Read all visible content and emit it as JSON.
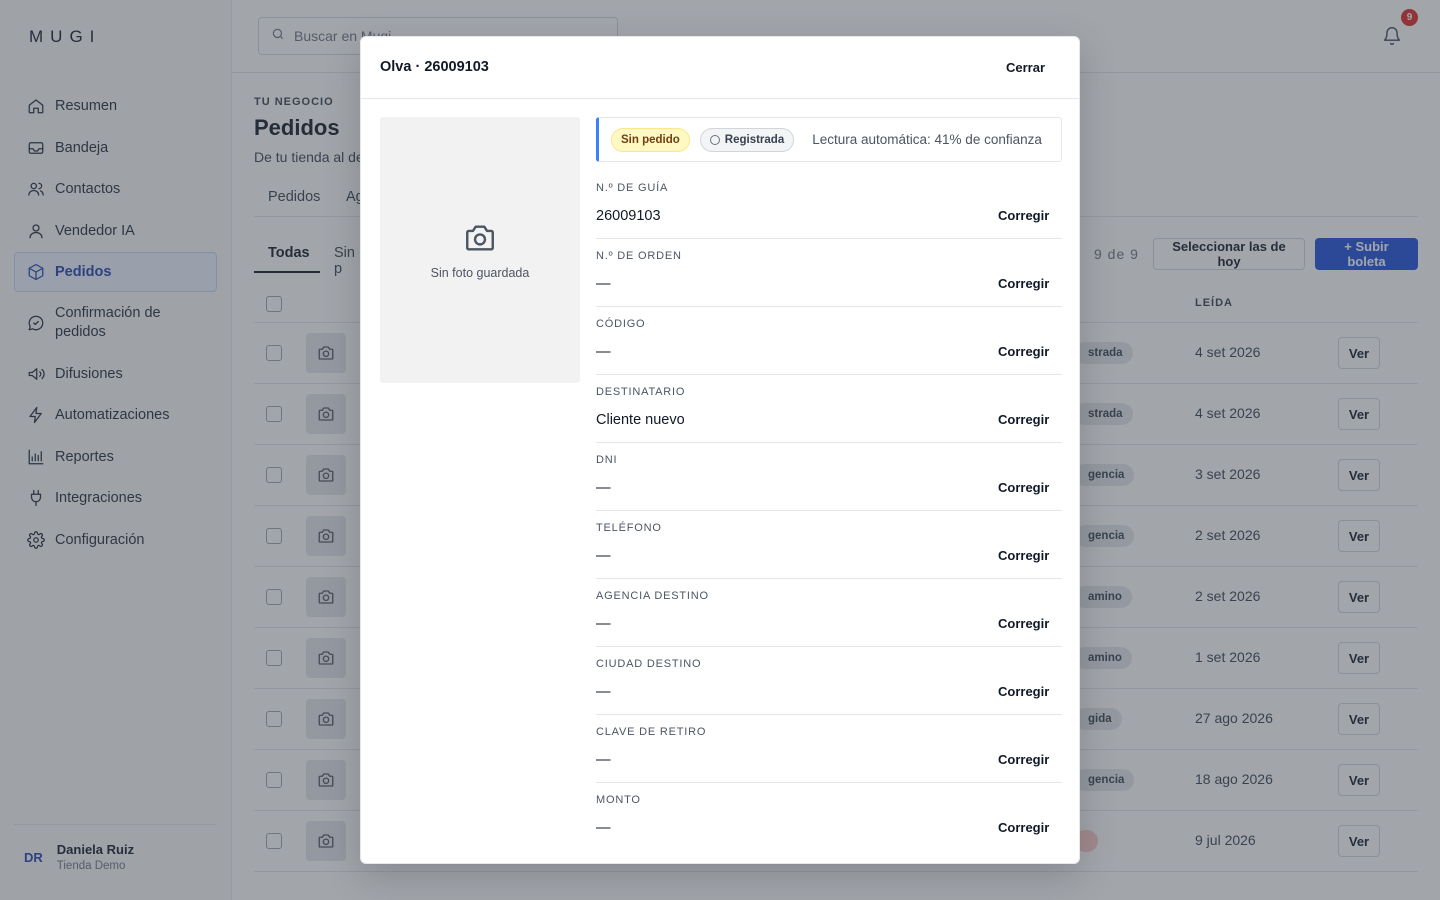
{
  "app": {
    "logo": "MUGI"
  },
  "sidebar": {
    "items": [
      {
        "label": "Resumen",
        "icon": "home-icon"
      },
      {
        "label": "Bandeja",
        "icon": "inbox-icon"
      },
      {
        "label": "Contactos",
        "icon": "users-icon"
      },
      {
        "label": "Vendedor IA",
        "icon": "user-icon"
      },
      {
        "label": "Pedidos",
        "icon": "box-icon",
        "active": true
      },
      {
        "label": "Confirmación de pedidos",
        "icon": "chat-bubble-icon"
      },
      {
        "label": "Difusiones",
        "icon": "megaphone-icon"
      },
      {
        "label": "Automatizaciones",
        "icon": "lightning-icon"
      },
      {
        "label": "Reportes",
        "icon": "bar-chart-icon"
      },
      {
        "label": "Integraciones",
        "icon": "plug-icon"
      },
      {
        "label": "Configuración",
        "icon": "gear-icon"
      }
    ],
    "user": {
      "initials": "DR",
      "name": "Daniela Ruiz",
      "shop": "Tienda Demo"
    }
  },
  "topbar": {
    "search_placeholder": "Buscar en Mugi",
    "notifications_count": "9"
  },
  "page": {
    "eyebrow": "TU NEGOCIO",
    "title": "Pedidos",
    "subtitle": "De tu tienda al de",
    "tabs": [
      "Pedidos",
      "Ag"
    ],
    "subtabs": [
      "Todas",
      "Sin p"
    ],
    "count": "9 de 9",
    "select_today_label": "Seleccionar las de hoy",
    "upload_label": "+ Subir boleta"
  },
  "table": {
    "header_read": "LEÍDA",
    "view_label": "Ver",
    "rows": [
      {
        "status": "strada",
        "date": "4 set 2026"
      },
      {
        "status": "strada",
        "date": "4 set 2026"
      },
      {
        "status": "gencia",
        "date": "3 set 2026"
      },
      {
        "status": "gencia",
        "date": "2 set 2026"
      },
      {
        "status": "amino",
        "date": "2 set 2026"
      },
      {
        "status": "amino",
        "date": "1 set 2026"
      },
      {
        "status": "gida",
        "date": "27 ago 2026"
      },
      {
        "status": "gencia",
        "date": "18 ago 2026"
      },
      {
        "status": "",
        "date": "9 jul 2026",
        "red": true
      }
    ]
  },
  "modal": {
    "title": "Olva · 26009103",
    "close_label": "Cerrar",
    "photo_label": "Sin foto guardada",
    "chips": {
      "order": "Sin pedido",
      "state": "Registrada"
    },
    "confidence_text": "Lectura automática: 41% de confianza",
    "fix_label": "Corregir",
    "fields": [
      {
        "label": "N.º DE GUÍA",
        "value": "26009103"
      },
      {
        "label": "N.º DE ORDEN",
        "value": "—"
      },
      {
        "label": "CÓDIGO",
        "value": "—"
      },
      {
        "label": "DESTINATARIO",
        "value": "Cliente nuevo"
      },
      {
        "label": "DNI",
        "value": "—"
      },
      {
        "label": "TELÉFONO",
        "value": "—"
      },
      {
        "label": "AGENCIA DESTINO",
        "value": "—"
      },
      {
        "label": "CIUDAD DESTINO",
        "value": "—"
      },
      {
        "label": "CLAVE DE RETIRO",
        "value": "—"
      },
      {
        "label": "MONTO",
        "value": "—"
      }
    ]
  },
  "colors": {
    "accent": "#1d4ed8",
    "danger": "#dc2626",
    "warning_chip": "#fef9c3"
  }
}
